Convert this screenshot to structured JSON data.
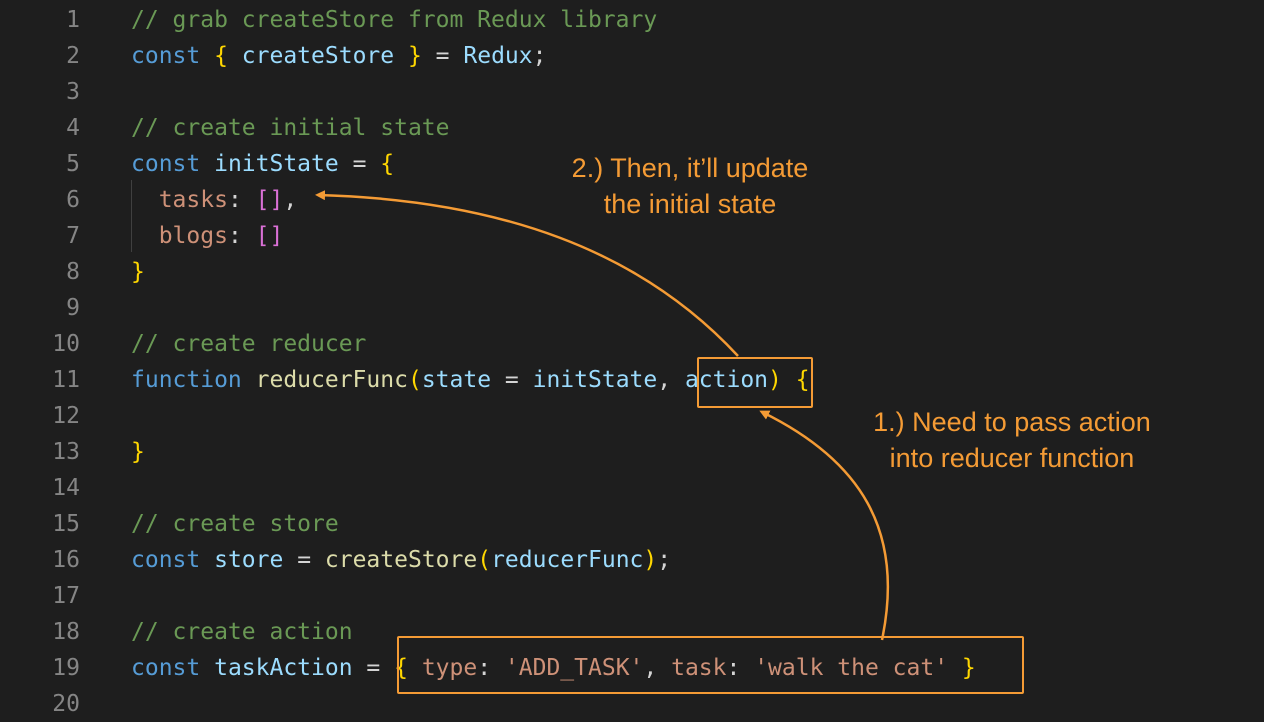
{
  "editor": {
    "lines": [
      {
        "num": "1",
        "tokens": [
          {
            "t": "// grab createStore from Redux library",
            "c": "comment"
          }
        ]
      },
      {
        "num": "2",
        "tokens": [
          {
            "t": "const ",
            "c": "kw"
          },
          {
            "t": "{ ",
            "c": "brace"
          },
          {
            "t": "createStore",
            "c": "var"
          },
          {
            "t": " } ",
            "c": "brace"
          },
          {
            "t": "= ",
            "c": "op"
          },
          {
            "t": "Redux",
            "c": "var"
          },
          {
            "t": ";",
            "c": "plain"
          }
        ]
      },
      {
        "num": "3",
        "tokens": []
      },
      {
        "num": "4",
        "tokens": [
          {
            "t": "// create initial state",
            "c": "comment"
          }
        ]
      },
      {
        "num": "5",
        "tokens": [
          {
            "t": "const ",
            "c": "kw"
          },
          {
            "t": "initState",
            "c": "var"
          },
          {
            "t": " = ",
            "c": "op"
          },
          {
            "t": "{",
            "c": "brace"
          }
        ]
      },
      {
        "num": "6",
        "tokens": [
          {
            "t": "  tasks",
            "c": "prop"
          },
          {
            "t": ": ",
            "c": "plain"
          },
          {
            "t": "[]",
            "c": "bracket"
          },
          {
            "t": ",",
            "c": "plain"
          }
        ]
      },
      {
        "num": "7",
        "tokens": [
          {
            "t": "  blogs",
            "c": "prop"
          },
          {
            "t": ": ",
            "c": "plain"
          },
          {
            "t": "[]",
            "c": "bracket"
          }
        ]
      },
      {
        "num": "8",
        "tokens": [
          {
            "t": "}",
            "c": "brace"
          }
        ]
      },
      {
        "num": "9",
        "tokens": []
      },
      {
        "num": "10",
        "tokens": [
          {
            "t": "// create reducer",
            "c": "comment"
          }
        ]
      },
      {
        "num": "11",
        "tokens": [
          {
            "t": "function ",
            "c": "kw"
          },
          {
            "t": "reducerFunc",
            "c": "fn"
          },
          {
            "t": "(",
            "c": "paren"
          },
          {
            "t": "state",
            "c": "param"
          },
          {
            "t": " = ",
            "c": "op"
          },
          {
            "t": "initState",
            "c": "var"
          },
          {
            "t": ", ",
            "c": "plain"
          },
          {
            "t": "action",
            "c": "param"
          },
          {
            "t": ")",
            "c": "paren"
          },
          {
            "t": " {",
            "c": "brace"
          }
        ]
      },
      {
        "num": "12",
        "tokens": []
      },
      {
        "num": "13",
        "tokens": [
          {
            "t": "}",
            "c": "brace"
          }
        ]
      },
      {
        "num": "14",
        "tokens": []
      },
      {
        "num": "15",
        "tokens": [
          {
            "t": "// create store",
            "c": "comment"
          }
        ]
      },
      {
        "num": "16",
        "tokens": [
          {
            "t": "const ",
            "c": "kw"
          },
          {
            "t": "store",
            "c": "var"
          },
          {
            "t": " = ",
            "c": "op"
          },
          {
            "t": "createStore",
            "c": "fn"
          },
          {
            "t": "(",
            "c": "paren"
          },
          {
            "t": "reducerFunc",
            "c": "var"
          },
          {
            "t": ")",
            "c": "paren"
          },
          {
            "t": ";",
            "c": "plain"
          }
        ]
      },
      {
        "num": "17",
        "tokens": []
      },
      {
        "num": "18",
        "tokens": [
          {
            "t": "// create action",
            "c": "comment"
          }
        ]
      },
      {
        "num": "19",
        "tokens": [
          {
            "t": "const ",
            "c": "kw"
          },
          {
            "t": "taskAction",
            "c": "var"
          },
          {
            "t": " = ",
            "c": "op"
          },
          {
            "t": "{ ",
            "c": "brace"
          },
          {
            "t": "type",
            "c": "prop"
          },
          {
            "t": ": ",
            "c": "plain"
          },
          {
            "t": "'ADD_TASK'",
            "c": "str"
          },
          {
            "t": ", ",
            "c": "plain"
          },
          {
            "t": "task",
            "c": "prop"
          },
          {
            "t": ": ",
            "c": "plain"
          },
          {
            "t": "'walk the cat'",
            "c": "str"
          },
          {
            "t": " }",
            "c": "brace"
          }
        ]
      },
      {
        "num": "20",
        "tokens": []
      }
    ]
  },
  "annotations": {
    "step2_line1": "2.) Then, it’ll update",
    "step2_line2": "the initial state",
    "step1_line1": "1.) Need to pass action",
    "step1_line2": "into reducer function"
  },
  "colors": {
    "background": "#1e1e1e",
    "annotation": "#f49b35",
    "line_number": "#858585"
  }
}
